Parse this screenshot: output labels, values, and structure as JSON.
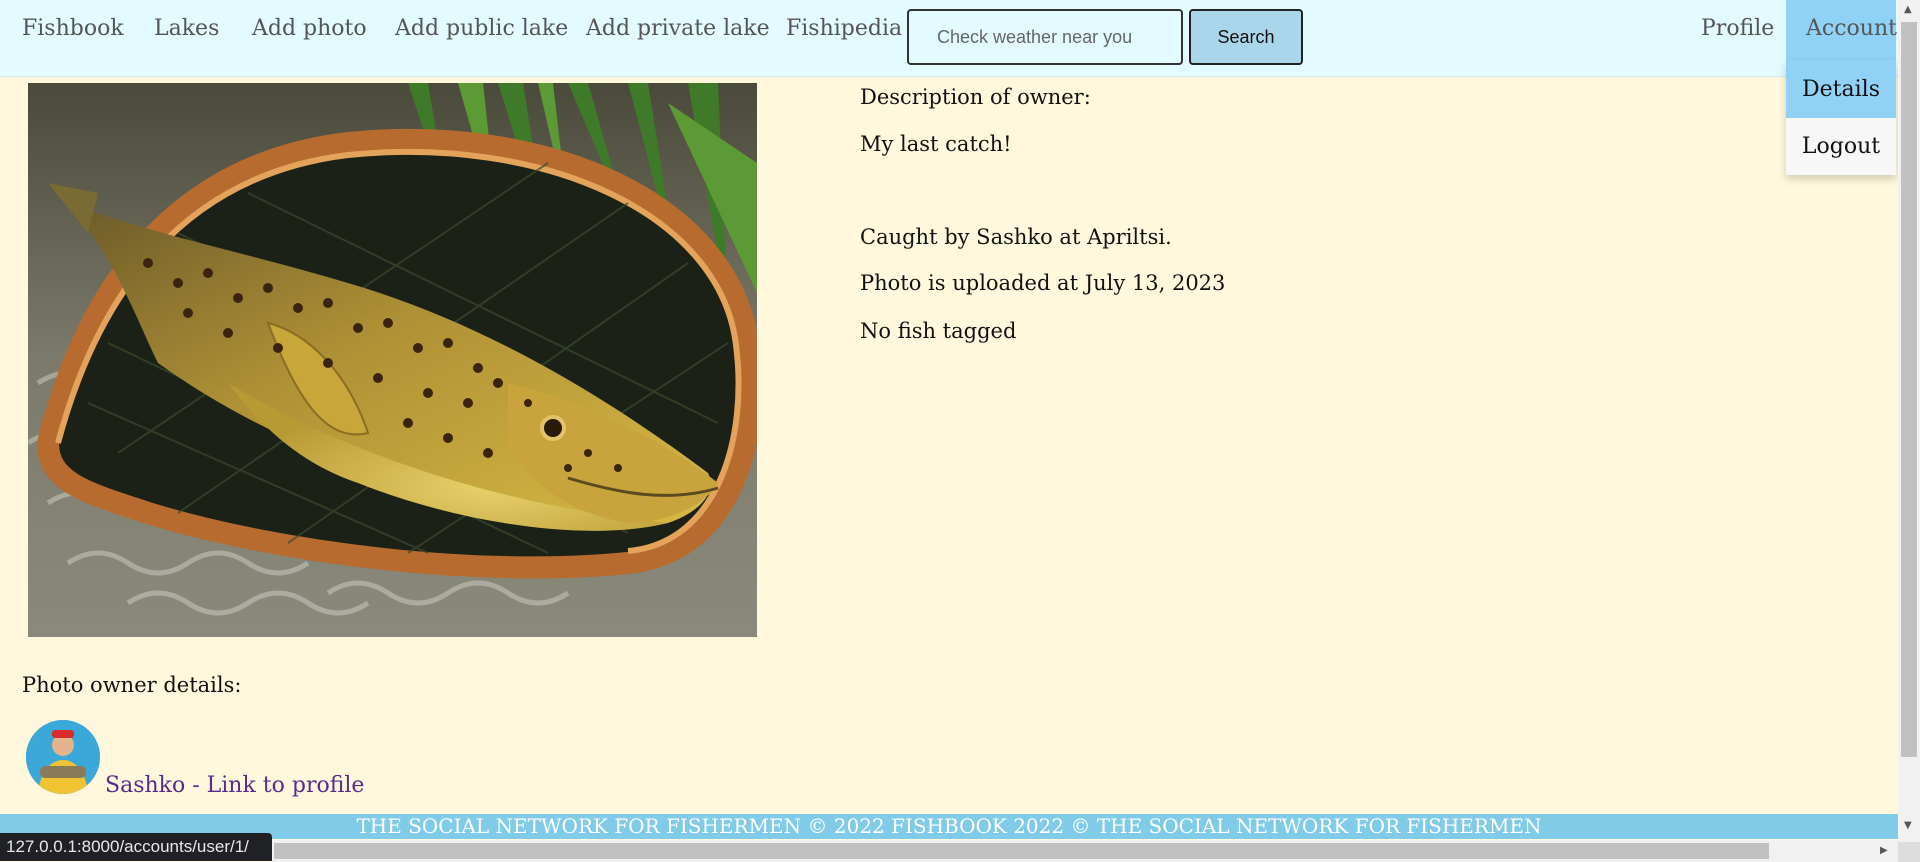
{
  "nav": {
    "brand": "Fishbook",
    "lakes": "Lakes",
    "add_photo": "Add photo",
    "add_public_lake": "Add public lake",
    "add_private_lake": "Add private lake",
    "fishipedia": "Fishipedia",
    "profile": "Profile",
    "account": "Account"
  },
  "search": {
    "placeholder": "Check weather near you",
    "button_label": "Search"
  },
  "account_menu": {
    "items": [
      {
        "label": "Details"
      },
      {
        "label": "Logout"
      }
    ]
  },
  "photo": {
    "description_heading": "Description of owner:",
    "description": "My last catch!",
    "caught_by": "Caught by Sashko at Apriltsi.",
    "uploaded": "Photo is uploaded at July 13, 2023",
    "tags": "No fish tagged"
  },
  "owner": {
    "heading": "Photo owner details:",
    "profile_link": "Sashko - Link to profile"
  },
  "footer": {
    "text": "THE SOCIAL NETWORK FOR FISHERMEN © 2022 FISHBOOK 2022 © THE SOCIAL NETWORK FOR FISHERMEN"
  },
  "status_bar": {
    "url": "127.0.0.1:8000/accounts/user/1/"
  },
  "colors": {
    "page_background": "#fff8dc",
    "navbar_background": "#e3fbff",
    "accent": "#8fd2f5",
    "footer_background": "#7fcbe8",
    "link": "#5a2a8c"
  }
}
